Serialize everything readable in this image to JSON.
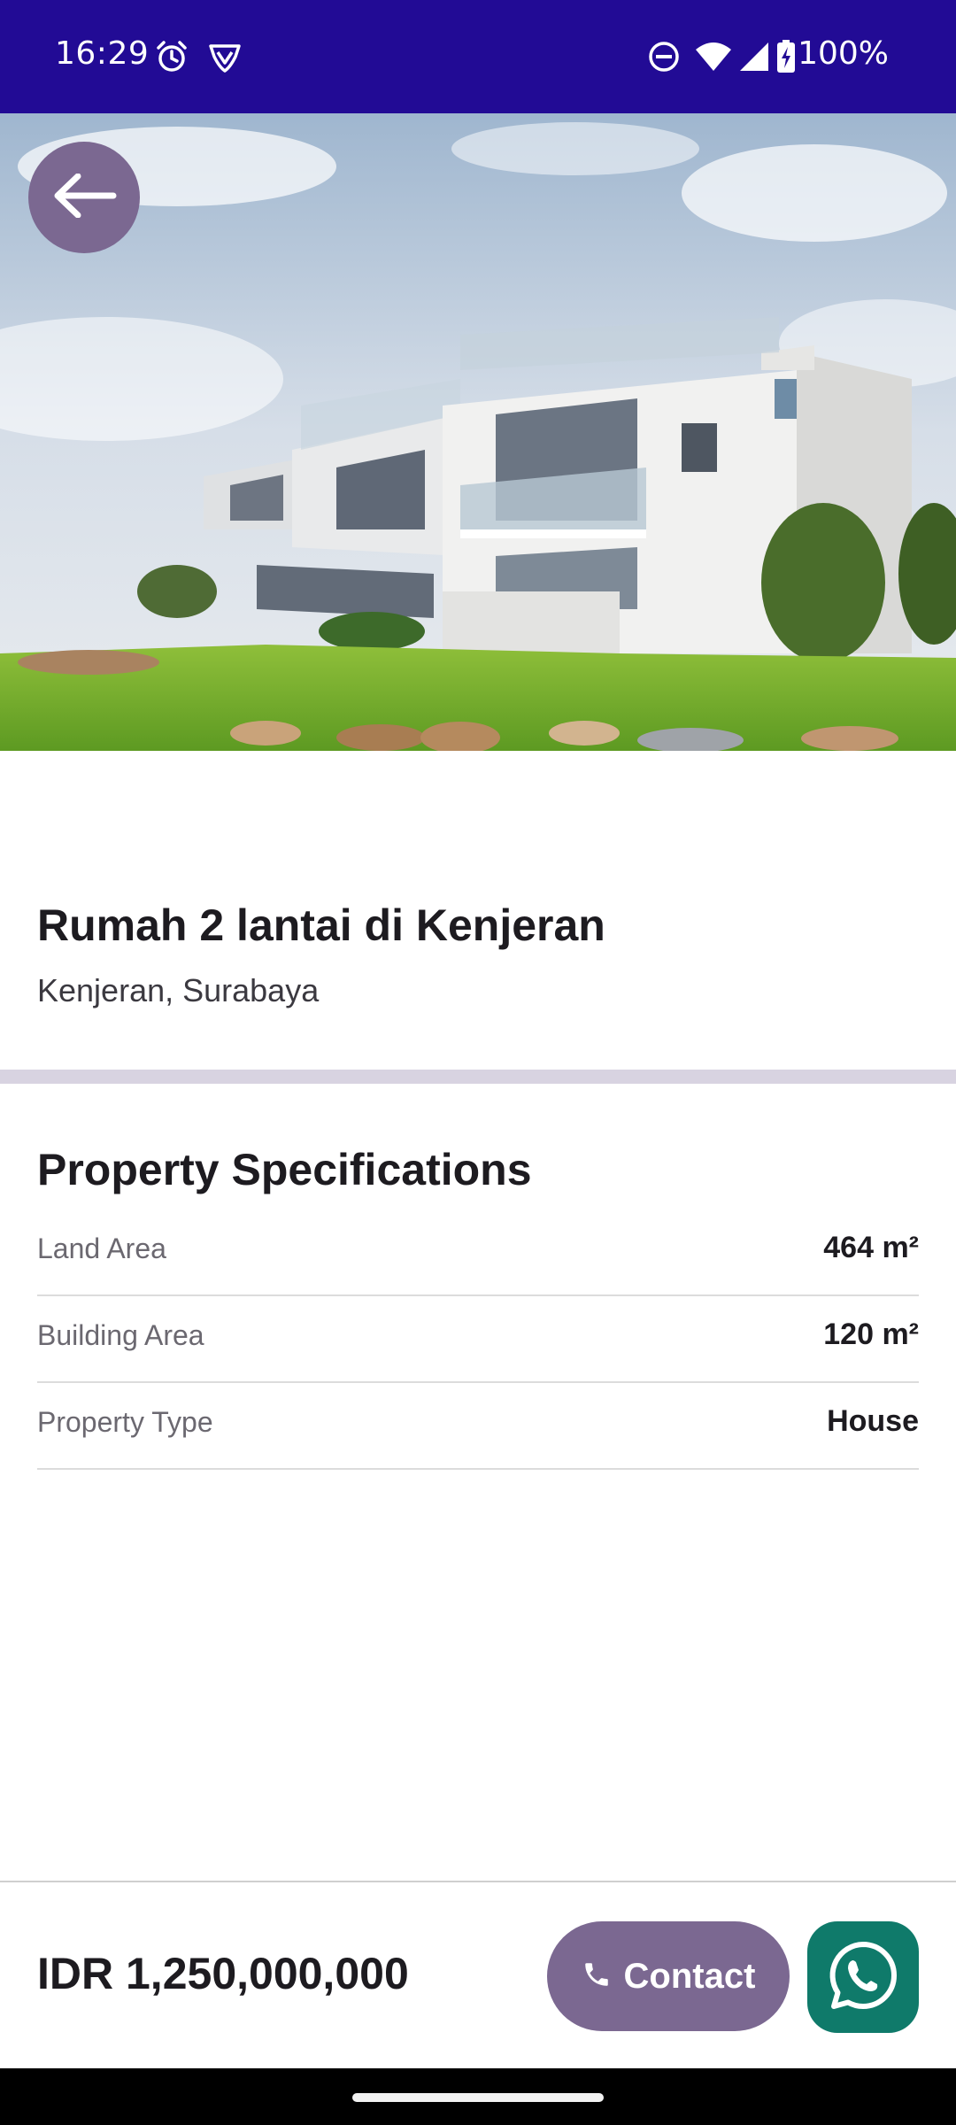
{
  "status_bar": {
    "time": "16:29",
    "battery_text": "100%",
    "icons": [
      "alarm-icon",
      "vpn-shield-icon",
      "do-not-disturb-icon",
      "wifi-icon",
      "cellular-signal-icon",
      "battery-charging-icon"
    ]
  },
  "hero": {
    "image": "modern-white-two-storey-house-photo",
    "back_icon": "arrow-left-icon"
  },
  "listing": {
    "title": "Rumah 2 lantai di Kenjeran",
    "location": "Kenjeran, Surabaya"
  },
  "specs": {
    "heading": "Property Specifications",
    "rows": [
      {
        "label": "Land Area",
        "value": "464 m²"
      },
      {
        "label": "Building Area",
        "value": "120 m²"
      },
      {
        "label": "Property Type",
        "value": "House"
      }
    ]
  },
  "bottom_bar": {
    "price": "IDR 1,250,000,000",
    "contact_label": "Contact",
    "contact_icon": "phone-icon",
    "whatsapp_icon": "whatsapp-icon"
  },
  "colors": {
    "status_bar": "#220b95",
    "accent": "#7b6891",
    "whatsapp": "#0f7a6a",
    "divider": "#d8d3e1"
  }
}
